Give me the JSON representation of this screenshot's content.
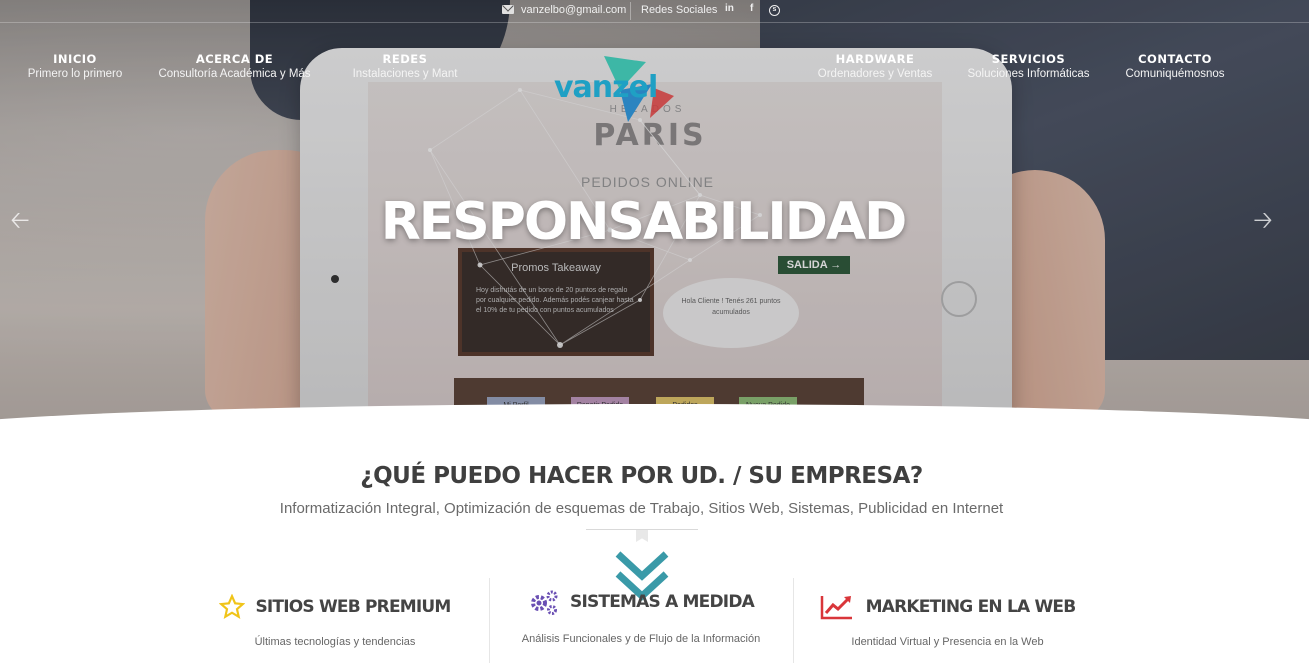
{
  "topbar": {
    "email": "vanzelbo@gmail.com",
    "social_label": "Redes Sociales",
    "icons": [
      "linkedin-icon",
      "facebook-icon",
      "skype-icon"
    ]
  },
  "nav": [
    {
      "title": "INICIO",
      "sub": "Primero lo primero"
    },
    {
      "title": "ACERCA DE",
      "sub": "Consultoría Académica y Más"
    },
    {
      "title": "REDES",
      "sub": "Instalaciones y Mant"
    },
    {
      "title": "HARDWARE",
      "sub": "Ordenadores y Ventas"
    },
    {
      "title": "SERVICIOS",
      "sub": "Soluciones Informáticas"
    },
    {
      "title": "CONTACTO",
      "sub": "Comuniquémosnos"
    }
  ],
  "logo": {
    "text": "vanzel"
  },
  "hero": {
    "slogan": "RESPONSABILIDAD",
    "screen": {
      "brand_top": "HELADOS",
      "brand": "PARIS",
      "brand_sub": "PEDIDOS ONLINE",
      "board_title": "Promos Takeaway",
      "board_text": "Hoy disfrutás de un bono de 20 puntos de regalo por cualquier pedido. Además podés canjear hasta el 10% de tu pedido con puntos acumulados",
      "exit_sign": "SALIDA →",
      "bubble": "Hola Cliente ! Tenés 261 puntos acumulados",
      "buttons": [
        "Mi Perfil",
        "Repetir Pedido",
        "Pedidos Pendientes",
        "Nuevo Pedido"
      ]
    }
  },
  "main": {
    "title": "¿QUÉ PUEDO HACER POR UD. / SU EMPRESA?",
    "subtitle": "Informatización Integral, Optimización de esquemas de Trabajo, Sitios Web, Sistemas, Publicidad en Internet"
  },
  "features": [
    {
      "icon": "star-icon",
      "title": "SITIOS WEB PREMIUM",
      "desc": "Últimas tecnologías y tendencias"
    },
    {
      "icon": "gears-icon",
      "title": "SISTEMAS A MEDIDA",
      "desc": "Análisis Funcionales y de Flujo de la Información"
    },
    {
      "icon": "line-chart-icon",
      "title": "MARKETING EN LA WEB",
      "desc": "Identidad Virtual y Presencia en la Web"
    }
  ],
  "colors": {
    "accent_teal": "#3a9aa8",
    "star": "#f0c419",
    "gears": "#6a4fb3",
    "chart": "#d9363a"
  }
}
